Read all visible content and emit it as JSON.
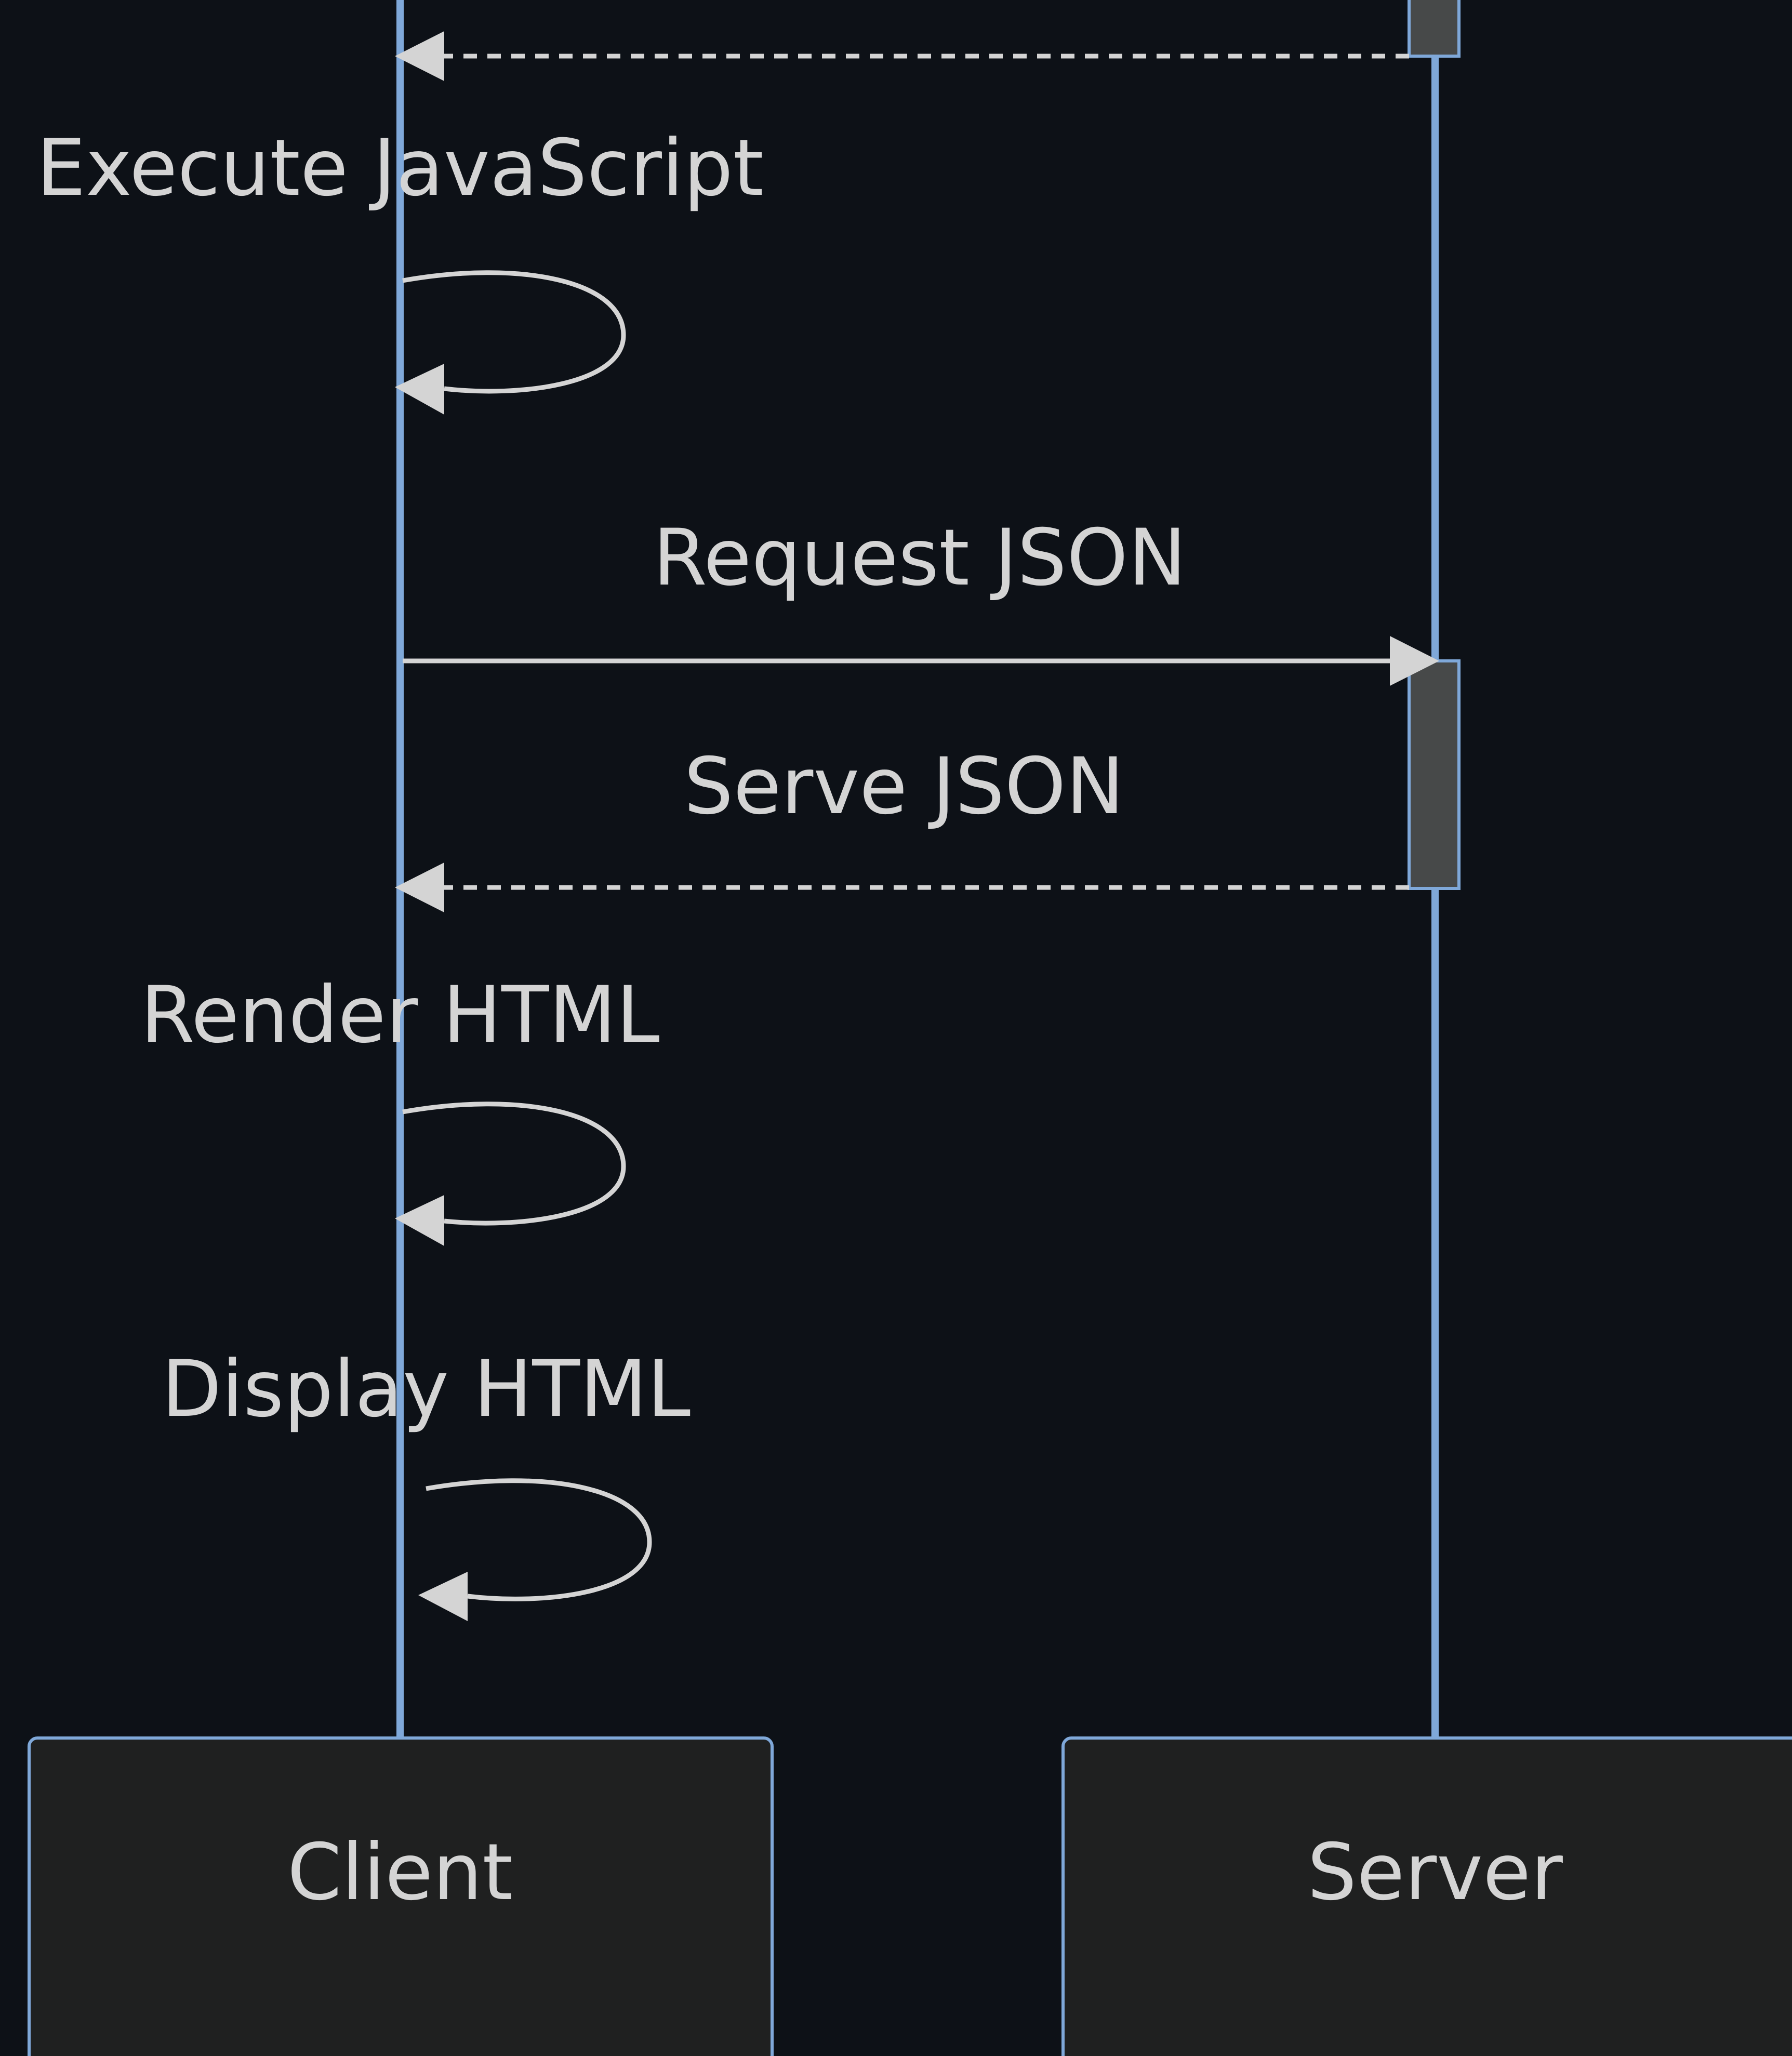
{
  "participants": [
    {
      "id": "client",
      "label": "Client"
    },
    {
      "id": "server",
      "label": "Server"
    }
  ],
  "messages": [
    {
      "from": "server",
      "to": "client",
      "label": "",
      "style": "dashed"
    },
    {
      "from": "client",
      "to": "client",
      "label": "Execute JavaScript",
      "style": "self"
    },
    {
      "from": "client",
      "to": "server",
      "label": "Request JSON",
      "style": "solid"
    },
    {
      "from": "server",
      "to": "client",
      "label": "Serve JSON",
      "style": "dashed"
    },
    {
      "from": "client",
      "to": "client",
      "label": "Render HTML",
      "style": "self"
    },
    {
      "from": "client",
      "to": "client",
      "label": "Display HTML",
      "style": "self"
    }
  ],
  "colors": {
    "background": "#0d1117",
    "lifeline": "#7fa8d9",
    "arrow": "#d4d4d4",
    "text": "#d4d4d4",
    "actor_fill": "#1f2020",
    "actor_border": "#7fa8d9",
    "activation_fill": "#474949"
  }
}
